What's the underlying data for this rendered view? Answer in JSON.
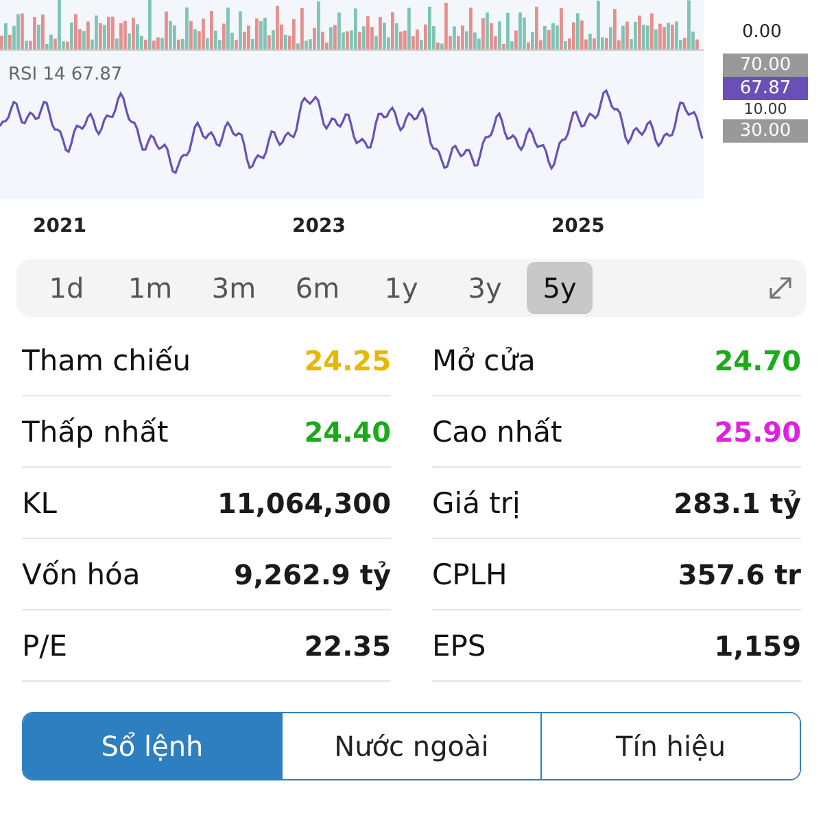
{
  "chart": {
    "volume_axis_label": "0.00",
    "rsi_label": "RSI 14 67.87",
    "rsi_axis": [
      {
        "label": "70.00",
        "kind": "level"
      },
      {
        "label": "67.87",
        "kind": "current"
      },
      {
        "label": "10.00",
        "kind": "plain"
      },
      {
        "label": "30.00",
        "kind": "level"
      }
    ],
    "years": [
      "2021",
      "2023",
      "2025"
    ]
  },
  "ranges": [
    {
      "label": "1d",
      "selected": false
    },
    {
      "label": "1m",
      "selected": false
    },
    {
      "label": "3m",
      "selected": false
    },
    {
      "label": "6m",
      "selected": false
    },
    {
      "label": "1y",
      "selected": false
    },
    {
      "label": "3y",
      "selected": false
    },
    {
      "label": "5y",
      "selected": true
    }
  ],
  "stats": [
    [
      {
        "label": "Tham chiếu",
        "value": "24.25",
        "color": "#e6b800"
      },
      {
        "label": "Mở cửa",
        "value": "24.70",
        "color": "#1aab1a"
      }
    ],
    [
      {
        "label": "Thấp nhất",
        "value": "24.40",
        "color": "#1aab1a"
      },
      {
        "label": "Cao nhất",
        "value": "25.90",
        "color": "#e020e0"
      }
    ],
    [
      {
        "label": "KL",
        "value": "11,064,300",
        "color": "#1a1a1a"
      },
      {
        "label": "Giá trị",
        "value": "283.1 tỷ",
        "color": "#1a1a1a"
      }
    ],
    [
      {
        "label": "Vốn hóa",
        "value": "9,262.9 tỷ",
        "color": "#1a1a1a"
      },
      {
        "label": "CPLH",
        "value": "357.6 tr",
        "color": "#1a1a1a"
      }
    ],
    [
      {
        "label": "P/E",
        "value": "22.35",
        "color": "#1a1a1a"
      },
      {
        "label": "EPS",
        "value": "1,159",
        "color": "#1a1a1a"
      }
    ]
  ],
  "bottom_tabs": [
    {
      "label": "Sổ lệnh",
      "selected": true
    },
    {
      "label": "Nước ngoài",
      "selected": false
    },
    {
      "label": "Tín hiệu",
      "selected": false
    }
  ]
}
